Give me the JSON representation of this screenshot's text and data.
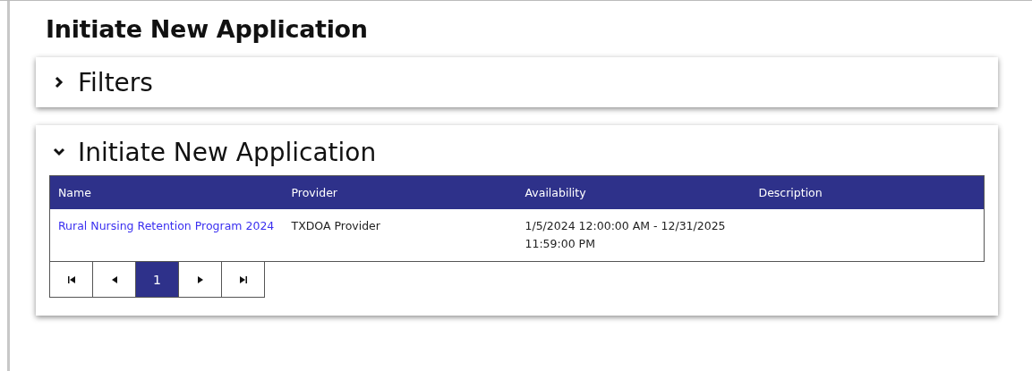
{
  "page_title": "Initiate New Application",
  "panels": [
    {
      "title": "Filters",
      "expanded": false
    },
    {
      "title": "Initiate New Application",
      "expanded": true,
      "table": {
        "columns": [
          "Name",
          "Provider",
          "Availability",
          "Description"
        ],
        "rows": [
          {
            "name": "Rural Nursing Retention Program 2024",
            "provider": "TXDOA Provider",
            "availability": "1/5/2024 12:00:00 AM - 12/31/2025 11:59:00 PM"
          }
        ]
      },
      "pager": {
        "pages": [
          {
            "label": "1",
            "selected": true
          }
        ]
      }
    }
  ]
}
